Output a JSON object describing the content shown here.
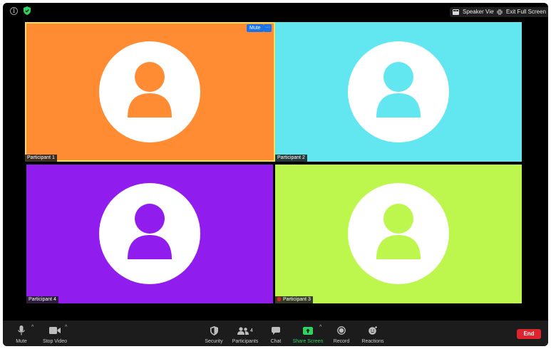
{
  "topbar": {
    "speaker_view_label": "Speaker View",
    "exit_full_screen_label": "Exit Full Screen"
  },
  "tiles": [
    {
      "name": "Participant 1",
      "color": "#ff8c33",
      "active": true,
      "hover_actions": {
        "mute_label": "Mute",
        "more_label": "···"
      }
    },
    {
      "name": "Participant 2",
      "color": "#62e6f0",
      "active": false
    },
    {
      "name": "Participant 4",
      "color": "#901ded",
      "active": false
    },
    {
      "name": "Participant 3",
      "color": "#bdf74d",
      "active": false
    }
  ],
  "toolbar": {
    "mute_label": "Mute",
    "stop_video_label": "Stop Video",
    "security_label": "Security",
    "participants_label": "Participants",
    "participants_count": "4",
    "chat_label": "Chat",
    "share_screen_label": "Share Screen",
    "record_label": "Record",
    "reactions_label": "Reactions",
    "end_label": "End"
  },
  "colors": {
    "share_green": "#2dd45e",
    "end_red": "#e0242d",
    "active_border": "#f2e35a"
  }
}
